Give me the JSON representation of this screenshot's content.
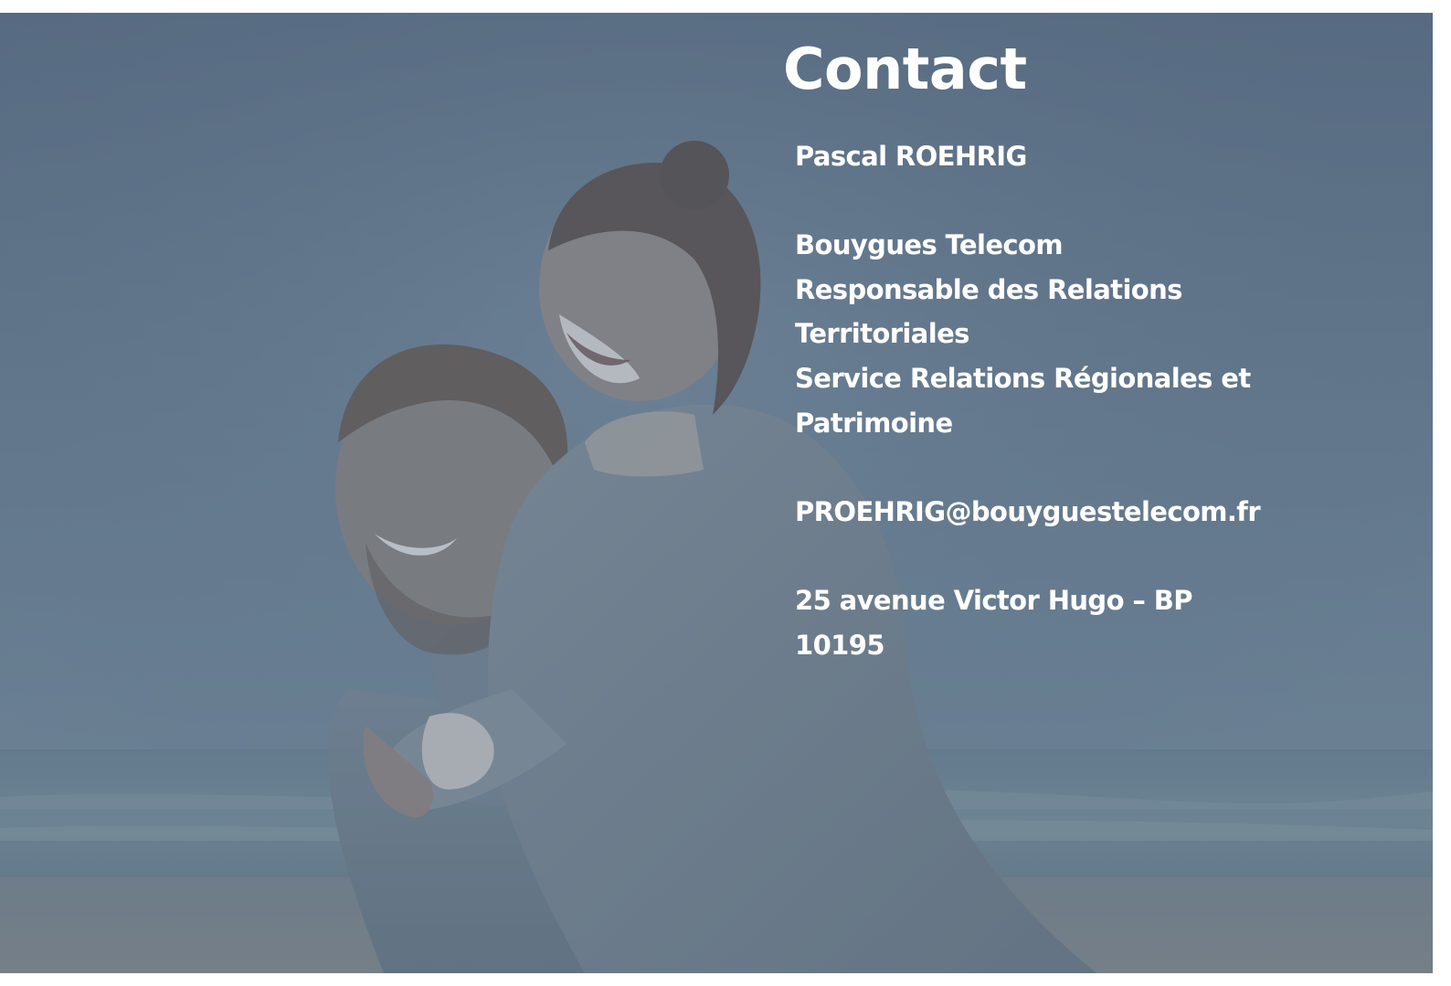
{
  "slide": {
    "title": "Contact",
    "contact": {
      "name": "Pascal ROEHRIG",
      "company": "Bouygues Telecom",
      "role_line1": "Responsable des Relations",
      "role_line2": "Territoriales",
      "service_line1": "Service Relations Régionales et",
      "service_line2": "Patrimoine",
      "email": "PROEHRIG@bouyguestelecom.fr",
      "address_line1": "25 avenue Victor Hugo – BP",
      "address_line2": "10195"
    }
  },
  "colors": {
    "text": "#ffffff",
    "overlay": "#5f7389",
    "sea": "#7d95a3",
    "sand": "#8c9295"
  }
}
